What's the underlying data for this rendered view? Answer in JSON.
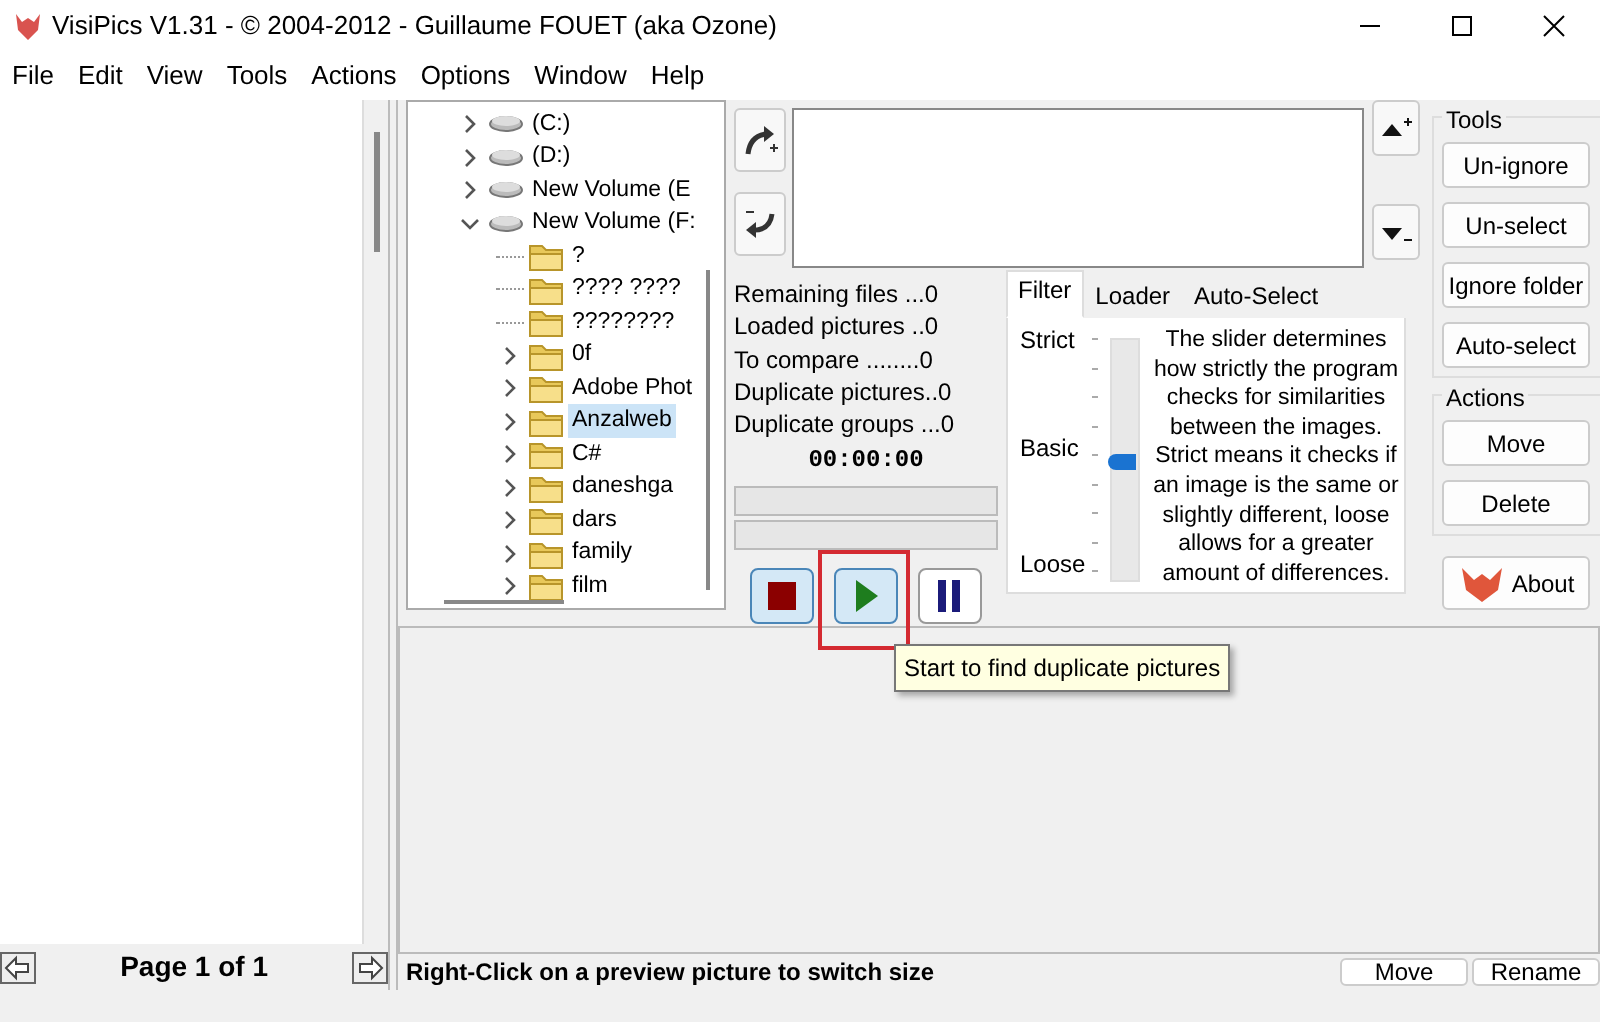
{
  "window": {
    "title": "VisiPics V1.31 - © 2004-2012 - Guillaume FOUET (aka Ozone)"
  },
  "menu": [
    "File",
    "Edit",
    "View",
    "Tools",
    "Actions",
    "Options",
    "Window",
    "Help"
  ],
  "tree": [
    {
      "label": "(C:)",
      "kind": "drive",
      "expandable": true,
      "expanded": false,
      "selected": false
    },
    {
      "label": "(D:)",
      "kind": "drive",
      "expandable": true,
      "expanded": false,
      "selected": false
    },
    {
      "label": "New Volume (E",
      "kind": "drive",
      "expandable": true,
      "expanded": false,
      "selected": false
    },
    {
      "label": "New Volume (F:",
      "kind": "drive",
      "expandable": true,
      "expanded": true,
      "selected": false,
      "children": [
        {
          "label": "?",
          "kind": "folder",
          "expandable": false,
          "selected": false
        },
        {
          "label": "???? ????",
          "kind": "folder",
          "expandable": false,
          "selected": false
        },
        {
          "label": "????????",
          "kind": "folder",
          "expandable": false,
          "selected": false
        },
        {
          "label": "0f",
          "kind": "folder",
          "expandable": true,
          "expanded": false,
          "selected": false
        },
        {
          "label": "Adobe Phot",
          "kind": "folder",
          "expandable": true,
          "expanded": false,
          "selected": false
        },
        {
          "label": "Anzalweb",
          "kind": "folder",
          "expandable": true,
          "expanded": false,
          "selected": true
        },
        {
          "label": "C#",
          "kind": "folder",
          "expandable": true,
          "expanded": false,
          "selected": false
        },
        {
          "label": "daneshga",
          "kind": "folder",
          "expandable": true,
          "expanded": false,
          "selected": false
        },
        {
          "label": "dars",
          "kind": "folder",
          "expandable": true,
          "expanded": false,
          "selected": false
        },
        {
          "label": "family",
          "kind": "folder",
          "expandable": true,
          "expanded": false,
          "selected": false
        },
        {
          "label": "film",
          "kind": "folder",
          "expandable": true,
          "expanded": false,
          "selected": false
        }
      ]
    }
  ],
  "stats": [
    "Remaining files ...0",
    "Loaded pictures ..0",
    "To compare ........0",
    "Duplicate pictures..0",
    "Duplicate groups ...0"
  ],
  "timer": "00:00:00",
  "progress": [
    {
      "level": 0
    },
    {
      "level": 0
    }
  ],
  "run_buttons": [
    {
      "kind": "stop",
      "active": true,
      "annotated": false
    },
    {
      "kind": "play",
      "active": true,
      "annotated": true
    },
    {
      "kind": "pause",
      "active": false,
      "annotated": false
    }
  ],
  "tooltip": "Start to find duplicate pictures",
  "tabs": [
    {
      "label": "Filter",
      "selected": true
    },
    {
      "label": "Loader",
      "selected": false
    },
    {
      "label": "Auto-Select",
      "selected": false
    }
  ],
  "filter": {
    "labels": [
      "Strict",
      "Basic",
      "Loose"
    ],
    "level": 0.5,
    "description": "The slider determines how strictly the program checks for similarities between the images. Strict means it checks if an image is the same or slightly different, loose allows for a greater amount of differences."
  },
  "tools": {
    "title": "Tools",
    "buttons": [
      "Un-ignore",
      "Un-select",
      "Ignore folder",
      "Auto-select"
    ]
  },
  "actions": {
    "title": "Actions",
    "buttons": [
      "Move",
      "Delete"
    ]
  },
  "about": "About",
  "pager": "Page 1 of 1",
  "status": {
    "text": "Right-Click on a preview picture to switch size",
    "buttons": [
      "Move",
      "Rename"
    ]
  }
}
